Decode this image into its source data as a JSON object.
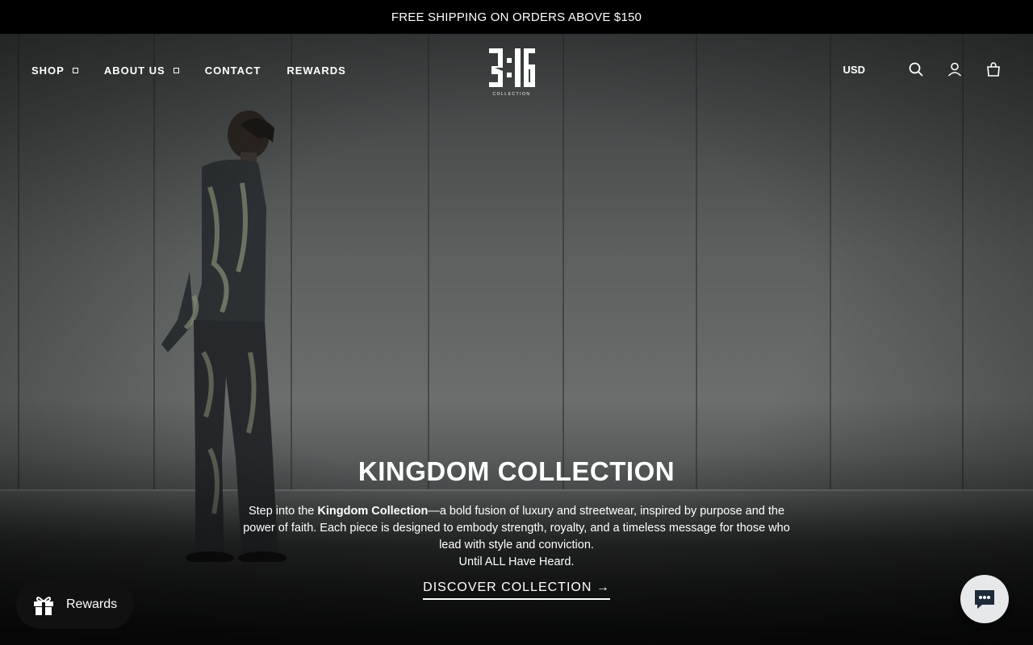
{
  "announcement": "FREE SHIPPING ON ORDERS ABOVE $150",
  "nav": {
    "left": [
      {
        "label": "SHOP",
        "dropdown": true
      },
      {
        "label": "ABOUT US",
        "dropdown": true
      },
      {
        "label": "CONTACT",
        "dropdown": false
      },
      {
        "label": "REWARDS",
        "dropdown": false
      }
    ],
    "logo_text": "3:16",
    "logo_subtext": "COLLECTION",
    "currency": "USD",
    "icons": [
      "search-icon",
      "account-icon",
      "cart-icon"
    ]
  },
  "hero": {
    "title": "KINGDOM COLLECTION",
    "desc_intro": "Step into the ",
    "desc_bold": "Kingdom Collection",
    "desc_rest": "—a bold fusion of luxury and streetwear, inspired by purpose and the power of faith. Each piece is designed to embody strength, royalty, and a timeless message for those who lead with style and conviction.",
    "desc_tagline": "Until ALL Have Heard.",
    "cta": "DISCOVER COLLECTION →"
  },
  "rewards_widget": {
    "label": "Rewards",
    "icon": "gift-icon"
  },
  "chat_widget": {
    "icon": "chat-icon"
  },
  "colors": {
    "background": "#000000",
    "text": "#ffffff",
    "chat_bg": "#e6e8ea"
  }
}
